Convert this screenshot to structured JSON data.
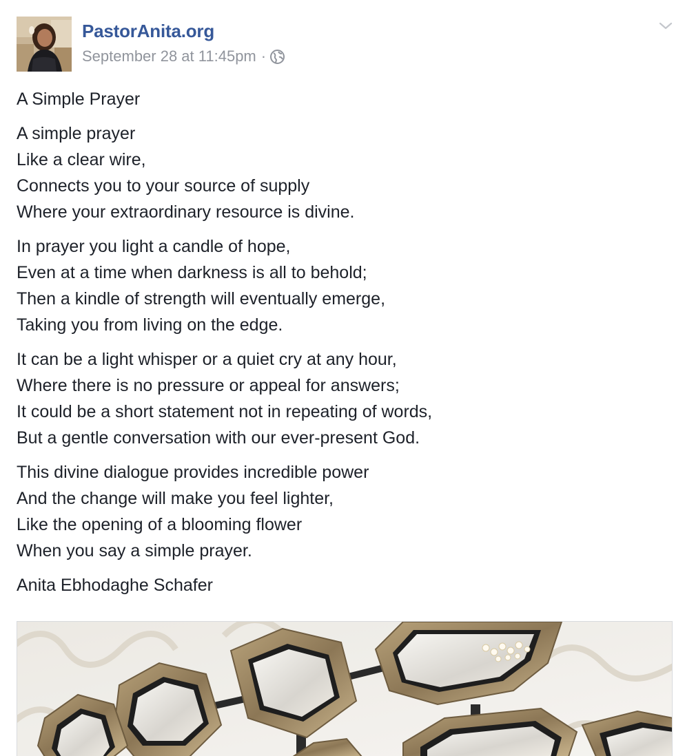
{
  "post": {
    "page_name": "PastorAnita.org",
    "timestamp": "September 28 at 11:45pm",
    "separator": "·",
    "privacy_icon": "globe-icon",
    "menu_icon": "chevron-down-icon",
    "title": "A Simple Prayer",
    "stanzas": [
      {
        "lines": [
          "A simple prayer",
          "Like a clear wire,",
          "Connects you to your source of supply",
          "Where your extraordinary resource is divine."
        ]
      },
      {
        "lines": [
          "In prayer you light a candle of hope,",
          "Even at a time when darkness is all to behold;",
          "Then a kindle of strength will eventually emerge,",
          "Taking you from living on the edge."
        ]
      },
      {
        "lines": [
          "It can be a light whisper or a quiet cry at any hour,",
          "Where there is no pressure or appeal for answers;",
          "It could be a short statement not in repeating of words,",
          "But a gentle conversation with our ever-present God."
        ]
      },
      {
        "lines": [
          "This divine dialogue provides incredible power",
          "And the change will make you feel lighter,",
          "Like the opening of a blooming flower",
          "When you say a simple prayer."
        ]
      }
    ],
    "author": "Anita Ebhodaghe Schafer"
  },
  "colors": {
    "link": "#365899",
    "meta": "#90949c",
    "text": "#1d2129"
  }
}
